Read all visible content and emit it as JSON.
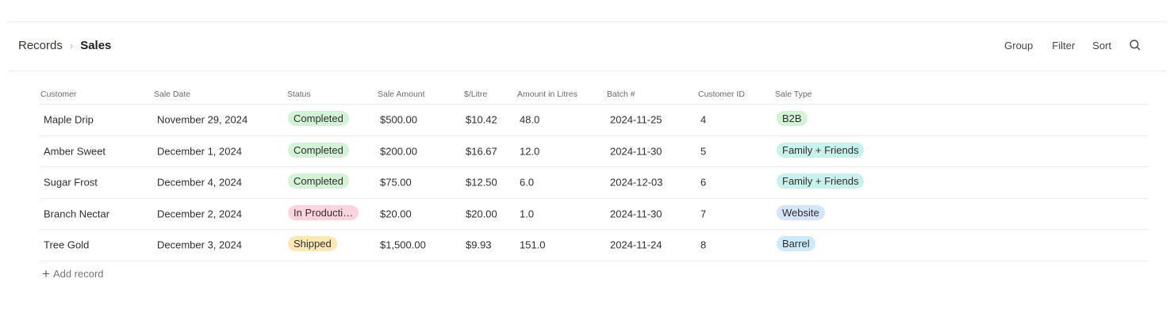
{
  "breadcrumb": {
    "parent": "Records",
    "separator": "›",
    "current": "Sales"
  },
  "toolbar": {
    "group": "Group",
    "filter": "Filter",
    "sort": "Sort",
    "search_icon": "search-icon"
  },
  "table": {
    "columns": [
      "Customer",
      "Sale Date",
      "Status",
      "Sale Amount",
      "$/Litre",
      "Amount in Litres",
      "Batch #",
      "Customer ID",
      "Sale Type"
    ],
    "rows": [
      {
        "customer": "Maple Drip",
        "sale_date": "November 29, 2024",
        "status": "Completed",
        "sale_amount": "$500.00",
        "per_litre": "$10.42",
        "litres": "48.0",
        "batch": "2024-11-25",
        "customer_id": "4",
        "sale_type": "B2B"
      },
      {
        "customer": "Amber Sweet",
        "sale_date": "December 1, 2024",
        "status": "Completed",
        "sale_amount": "$200.00",
        "per_litre": "$16.67",
        "litres": "12.0",
        "batch": "2024-11-30",
        "customer_id": "5",
        "sale_type": "Family + Friends"
      },
      {
        "customer": "Sugar Frost",
        "sale_date": "December 4, 2024",
        "status": "Completed",
        "sale_amount": "$75.00",
        "per_litre": "$12.50",
        "litres": "6.0",
        "batch": "2024-12-03",
        "customer_id": "6",
        "sale_type": "Family + Friends"
      },
      {
        "customer": "Branch Nectar",
        "sale_date": "December 2, 2024",
        "status": "In Producti…",
        "sale_amount": "$20.00",
        "per_litre": "$20.00",
        "litres": "1.0",
        "batch": "2024-11-30",
        "customer_id": "7",
        "sale_type": "Website"
      },
      {
        "customer": "Tree Gold",
        "sale_date": "December 3, 2024",
        "status": "Shipped",
        "sale_amount": "$1,500.00",
        "per_litre": "$9.93",
        "litres": "151.0",
        "batch": "2024-11-24",
        "customer_id": "8",
        "sale_type": "Barrel"
      }
    ]
  },
  "status_colors": {
    "Completed": "#d3f2d6",
    "In Producti…": "#fcd4df",
    "Shipped": "#fde8b5"
  },
  "sale_type_colors": {
    "B2B": "#d3f2d6",
    "Family + Friends": "#c9f1ec",
    "Website": "#d6e4fb",
    "Barrel": "#cdeafb"
  },
  "add_record": {
    "icon": "plus-icon",
    "label": "Add record"
  }
}
